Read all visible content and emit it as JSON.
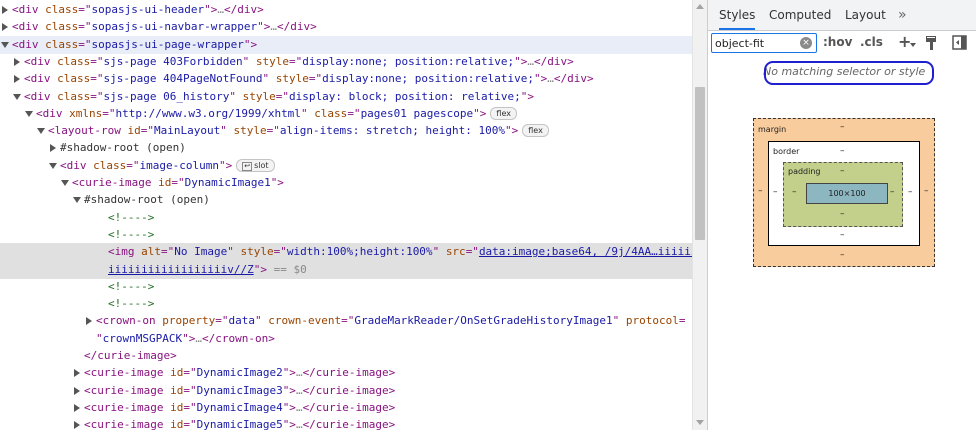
{
  "elements": {
    "lines": [
      [
        [
          "tag",
          "<div "
        ],
        [
          "an",
          "class"
        ],
        [
          "tag",
          "=\""
        ],
        [
          "av",
          "sopasjs-ui-header"
        ],
        [
          "tag",
          "\">"
        ],
        [
          "dim",
          "…"
        ],
        [
          "tag",
          "</div>"
        ]
      ],
      [
        [
          "tag",
          "<div "
        ],
        [
          "an",
          "class"
        ],
        [
          "tag",
          "=\""
        ],
        [
          "av",
          "sopasjs-ui-navbar-wrapper"
        ],
        [
          "tag",
          "\">"
        ],
        [
          "dim",
          "…"
        ],
        [
          "tag",
          "</div>"
        ]
      ],
      [
        [
          "tag",
          "<div "
        ],
        [
          "an",
          "class"
        ],
        [
          "tag",
          "=\""
        ],
        [
          "av",
          "sopasjs-ui-page-wrapper"
        ],
        [
          "tag",
          "\">"
        ]
      ],
      [
        [
          "tag",
          "<div "
        ],
        [
          "an",
          "class"
        ],
        [
          "tag",
          "=\""
        ],
        [
          "av",
          "sjs-page 403Forbidden"
        ],
        [
          "tag",
          "\" "
        ],
        [
          "an",
          "style"
        ],
        [
          "tag",
          "=\""
        ],
        [
          "av",
          "display:none; position:relative;"
        ],
        [
          "tag",
          "\">"
        ],
        [
          "dim",
          "…"
        ],
        [
          "tag",
          "</div>"
        ]
      ],
      [
        [
          "tag",
          "<div "
        ],
        [
          "an",
          "class"
        ],
        [
          "tag",
          "=\""
        ],
        [
          "av",
          "sjs-page 404PageNotFound"
        ],
        [
          "tag",
          "\" "
        ],
        [
          "an",
          "style"
        ],
        [
          "tag",
          "=\""
        ],
        [
          "av",
          "display:none; position:relative;"
        ],
        [
          "tag",
          "\">"
        ],
        [
          "dim",
          "…"
        ],
        [
          "tag",
          "</div>"
        ]
      ],
      [
        [
          "tag",
          "<div "
        ],
        [
          "an",
          "class"
        ],
        [
          "tag",
          "=\""
        ],
        [
          "av",
          "sjs-page 06_history"
        ],
        [
          "tag",
          "\" "
        ],
        [
          "an",
          "style"
        ],
        [
          "tag",
          "=\""
        ],
        [
          "av",
          "display: block; position: relative;"
        ],
        [
          "tag",
          "\">"
        ]
      ],
      [
        [
          "tag",
          "<div "
        ],
        [
          "an",
          "xmlns"
        ],
        [
          "tag",
          "=\""
        ],
        [
          "av",
          "http://www.w3.org/1999/xhtml"
        ],
        [
          "tag",
          "\" "
        ],
        [
          "an",
          "class"
        ],
        [
          "tag",
          "=\""
        ],
        [
          "av",
          "pages01 pagescope"
        ],
        [
          "tag",
          "\">"
        ]
      ],
      [
        [
          "tag",
          "<layout-row "
        ],
        [
          "an",
          "id"
        ],
        [
          "tag",
          "=\""
        ],
        [
          "av",
          "MainLayout"
        ],
        [
          "tag",
          "\" "
        ],
        [
          "an",
          "style"
        ],
        [
          "tag",
          "=\""
        ],
        [
          "av",
          "align-items: stretch; height: 100%"
        ],
        [
          "tag",
          "\">"
        ]
      ],
      [
        [
          "txt",
          "#shadow-root (open)"
        ]
      ],
      [
        [
          "tag",
          "<div "
        ],
        [
          "an",
          "class"
        ],
        [
          "tag",
          "=\""
        ],
        [
          "av",
          "image-column"
        ],
        [
          "tag",
          "\">"
        ]
      ],
      [
        [
          "tag",
          "<curie-image "
        ],
        [
          "an",
          "id"
        ],
        [
          "tag",
          "=\""
        ],
        [
          "av",
          "DynamicImage1"
        ],
        [
          "tag",
          "\">"
        ]
      ],
      [
        [
          "txt",
          "#shadow-root (open)"
        ]
      ],
      [
        [
          "cm",
          "<!---->"
        ]
      ],
      [
        [
          "cm",
          "<!---->"
        ]
      ],
      [
        [
          "tag",
          "<img "
        ],
        [
          "an",
          "alt"
        ],
        [
          "tag",
          "=\""
        ],
        [
          "av",
          "No Image"
        ],
        [
          "tag",
          "\" "
        ],
        [
          "an",
          "style"
        ],
        [
          "tag",
          "=\""
        ],
        [
          "av",
          "width:100%;height:100%"
        ],
        [
          "tag",
          "\" "
        ],
        [
          "an",
          "src"
        ],
        [
          "tag",
          "=\""
        ],
        [
          "link",
          "data:image;base64, /9j/4AA…iiiiii"
        ]
      ],
      [
        [
          "link",
          "iiiiiiiiiiiiiiiiiiv//Z"
        ],
        [
          "tag",
          "\">"
        ],
        [
          "dim",
          " == $0"
        ]
      ],
      [
        [
          "cm",
          "<!---->"
        ]
      ],
      [
        [
          "cm",
          "<!---->"
        ]
      ],
      [
        [
          "tag",
          "<crown-on "
        ],
        [
          "an",
          "property"
        ],
        [
          "tag",
          "=\""
        ],
        [
          "av",
          "data"
        ],
        [
          "tag",
          "\" "
        ],
        [
          "an",
          "crown-event"
        ],
        [
          "tag",
          "=\""
        ],
        [
          "av",
          "GradeMarkReader/OnSetGradeHistoryImage1"
        ],
        [
          "tag",
          "\" "
        ],
        [
          "an",
          "protocol"
        ],
        [
          "tag",
          "="
        ]
      ],
      [
        [
          "tag",
          "\""
        ],
        [
          "av",
          "crownMSGPACK"
        ],
        [
          "tag",
          "\">"
        ],
        [
          "dim",
          "…"
        ],
        [
          "tag",
          "</crown-on>"
        ]
      ],
      [
        [
          "tag",
          "</curie-image>"
        ]
      ],
      [
        [
          "tag",
          "<curie-image "
        ],
        [
          "an",
          "id"
        ],
        [
          "tag",
          "=\""
        ],
        [
          "av",
          "DynamicImage2"
        ],
        [
          "tag",
          "\">"
        ],
        [
          "dim",
          "…"
        ],
        [
          "tag",
          "</curie-image>"
        ]
      ],
      [
        [
          "tag",
          "<curie-image "
        ],
        [
          "an",
          "id"
        ],
        [
          "tag",
          "=\""
        ],
        [
          "av",
          "DynamicImage3"
        ],
        [
          "tag",
          "\">"
        ],
        [
          "dim",
          "…"
        ],
        [
          "tag",
          "</curie-image>"
        ]
      ],
      [
        [
          "tag",
          "<curie-image "
        ],
        [
          "an",
          "id"
        ],
        [
          "tag",
          "=\""
        ],
        [
          "av",
          "DynamicImage4"
        ],
        [
          "tag",
          "\">"
        ],
        [
          "dim",
          "…"
        ],
        [
          "tag",
          "</curie-image>"
        ]
      ],
      [
        [
          "tag",
          "<curie-image "
        ],
        [
          "an",
          "id"
        ],
        [
          "tag",
          "=\""
        ],
        [
          "av",
          "DynamicImage5"
        ],
        [
          "tag",
          "\">"
        ],
        [
          "dim",
          "…"
        ],
        [
          "tag",
          "</curie-image>"
        ]
      ]
    ],
    "badges": {
      "flex": "flex",
      "slot": "slot"
    }
  },
  "sidebar": {
    "tabs": [
      {
        "label": "Styles",
        "active": true
      },
      {
        "label": "Computed",
        "active": false
      },
      {
        "label": "Layout",
        "active": false
      }
    ],
    "more_tabs": "»",
    "filter_value": "object-fit",
    "filter_clear": "×",
    "hov_label": ":hov",
    "cls_label": ".cls",
    "add_label": "+",
    "no_match_text": "No matching selector or style",
    "box_model": {
      "margin_label": "margin",
      "border_label": "border",
      "padding_label": "padding",
      "content_size": "100×100",
      "dash": "–"
    }
  }
}
